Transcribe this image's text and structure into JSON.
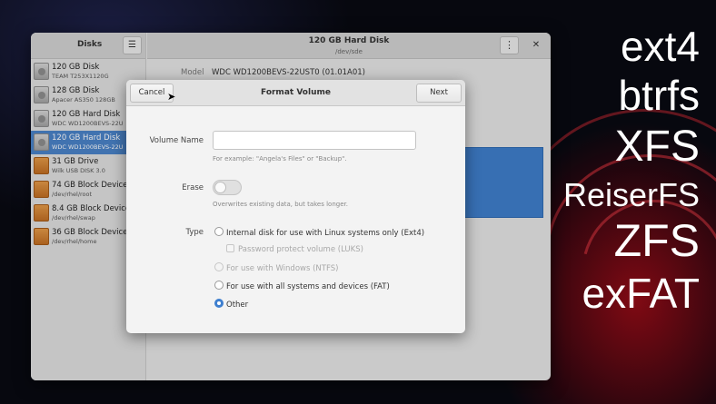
{
  "sidebar": {
    "title": "Disks",
    "menu_icon": "hamburger-icon",
    "disks": [
      {
        "name": "120 GB Disk",
        "sub": "TEAM T253X1120G",
        "icon": "hdd-icon",
        "selected": false
      },
      {
        "name": "128 GB Disk",
        "sub": "Apacer AS350 128GB",
        "icon": "hdd-icon",
        "selected": false
      },
      {
        "name": "120 GB Hard Disk",
        "sub": "WDC WD1200BEVS-22U",
        "icon": "hdd-icon",
        "selected": false
      },
      {
        "name": "120 GB Hard Disk",
        "sub": "WDC WD1200BEVS-22U",
        "icon": "hdd-icon",
        "selected": true
      },
      {
        "name": "31 GB Drive",
        "sub": "Wilk USB DISK 3.0",
        "icon": "usb-drive-icon",
        "selected": false
      },
      {
        "name": "74 GB Block Device",
        "sub": "/dev/rhel/root",
        "icon": "block-device-icon",
        "selected": false
      },
      {
        "name": "8.4 GB Block Device",
        "sub": "/dev/rhel/swap",
        "icon": "block-device-icon",
        "selected": false
      },
      {
        "name": "36 GB Block Device",
        "sub": "/dev/rhel/home",
        "icon": "block-device-icon",
        "selected": false
      }
    ]
  },
  "content": {
    "title": "120 GB Hard Disk",
    "subtitle": "/dev/sde",
    "model_label": "Model",
    "model_value": "WDC WD1200BEVS-22UST0 (01.01A01)"
  },
  "dialog": {
    "title": "Format Volume",
    "cancel_label": "Cancel",
    "next_label": "Next",
    "volume_name_label": "Volume Name",
    "volume_name_value": "",
    "volume_name_hint": "For example: \"Angela's Files\" or \"Backup\".",
    "erase_label": "Erase",
    "erase_on": false,
    "erase_hint": "Overwrites existing data, but takes longer.",
    "type_label": "Type",
    "options": {
      "ext4": "Internal disk for use with Linux systems only (Ext4)",
      "luks": "Password protect volume (LUKS)",
      "ntfs": "For use with Windows (NTFS)",
      "fat": "For use with all systems and devices (FAT)",
      "other": "Other"
    },
    "selected_type": "Other"
  },
  "overlay_words": [
    "ext4",
    "btrfs",
    "XFS",
    "ReiserFS",
    "ZFS",
    "exFAT"
  ],
  "colors": {
    "selection": "#4a83c9",
    "radio_accent": "#3e7fcf",
    "overlay_text": "#ffffff"
  }
}
